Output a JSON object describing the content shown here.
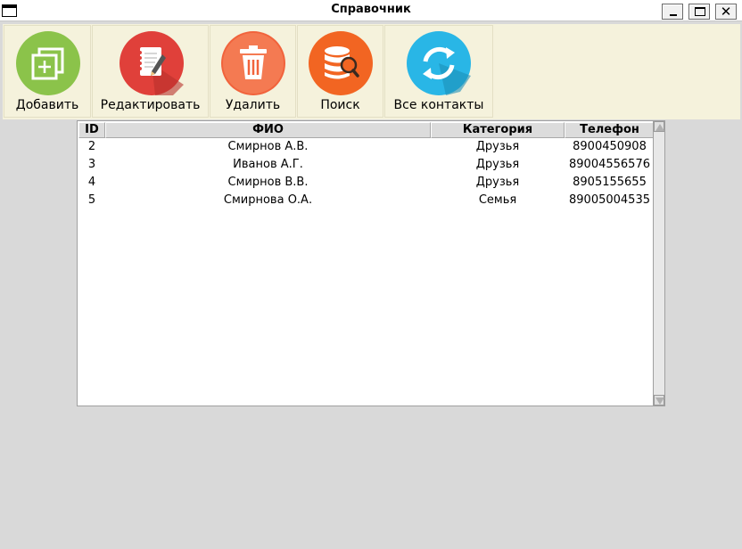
{
  "window": {
    "title": "Справочник",
    "controls": [
      "minimize",
      "maximize",
      "close"
    ],
    "close_glyph": "✕"
  },
  "toolbar": {
    "add": {
      "label": "Добавить",
      "icon": "add-icon",
      "color": "#8bc34a"
    },
    "edit": {
      "label": "Редактировать",
      "icon": "notepad-edit-icon",
      "color": "#e0403a"
    },
    "delete": {
      "label": "Удалить",
      "icon": "trash-icon",
      "color": "#f1633c"
    },
    "search": {
      "label": "Поиск",
      "icon": "database-search-icon",
      "color": "#f26522"
    },
    "all_contacts": {
      "label": "Все контакты",
      "icon": "refresh-icon",
      "color": "#29b6e6"
    }
  },
  "table": {
    "columns": [
      "ID",
      "ФИО",
      "Категория",
      "Телефон"
    ],
    "rows": [
      [
        "2",
        "Смирнов А.В.",
        "Друзья",
        "8900450908"
      ],
      [
        "3",
        "Иванов А.Г.",
        "Друзья",
        "89004556576"
      ],
      [
        "4",
        "Смирнов В.В.",
        "Друзья",
        "8905155655"
      ],
      [
        "5",
        "Смирнова О.А.",
        "Семья",
        "89005004535"
      ]
    ]
  }
}
